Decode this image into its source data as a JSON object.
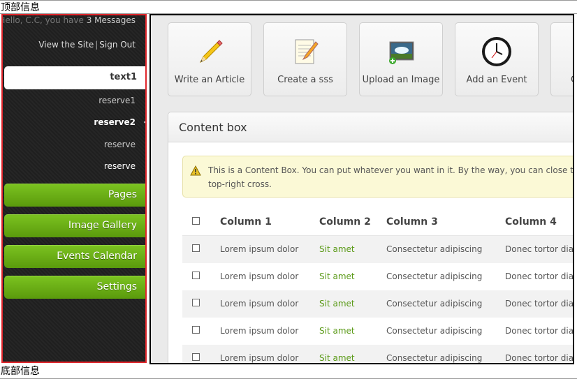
{
  "top_info": "顶部信息",
  "bottom_info": "底部信息",
  "sidebar": {
    "greeting_prefix": "Hello, C.C, you have ",
    "message_count": "3 Messages",
    "view_site": "View the Site",
    "separator": "|",
    "sign_out": "Sign Out",
    "active_item": "text1",
    "sub_items": [
      "reserve1",
      "reserve2",
      "reserve",
      "reserve"
    ],
    "green_buttons": [
      "Pages",
      "Image Gallery",
      "Events Calendar",
      "Settings"
    ]
  },
  "shortcuts": [
    {
      "label": "Write an Article",
      "icon": "pencil-icon"
    },
    {
      "label": "Create a sss",
      "icon": "notepad-icon"
    },
    {
      "label": "Upload an Image",
      "icon": "image-upload-icon"
    },
    {
      "label": "Add an Event",
      "icon": "clock-icon"
    },
    {
      "label": "C",
      "icon": "partial-icon"
    }
  ],
  "content_box": {
    "title": "Content box",
    "notice_line1": "This is a Content Box. You can put whatever you want in it. By the way, you can close this",
    "notice_line2": "top-right cross.",
    "columns": [
      "Column 1",
      "Column 2",
      "Column 3",
      "Column 4"
    ],
    "rows": [
      [
        "Lorem ipsum dolor",
        "Sit amet",
        "Consectetur adipiscing",
        "Donec tortor diam"
      ],
      [
        "Lorem ipsum dolor",
        "Sit amet",
        "Consectetur adipiscing",
        "Donec tortor diam"
      ],
      [
        "Lorem ipsum dolor",
        "Sit amet",
        "Consectetur adipiscing",
        "Donec tortor diam"
      ],
      [
        "Lorem ipsum dolor",
        "Sit amet",
        "Consectetur adipiscing",
        "Donec tortor diam"
      ],
      [
        "Lorem ipsum dolor",
        "Sit amet",
        "Consectetur adipiscing",
        "Donec tortor diam"
      ]
    ]
  },
  "colors": {
    "sidebar_border": "#e0262c",
    "accent_green": "#5b9a18",
    "button_green": "#6aac16"
  }
}
